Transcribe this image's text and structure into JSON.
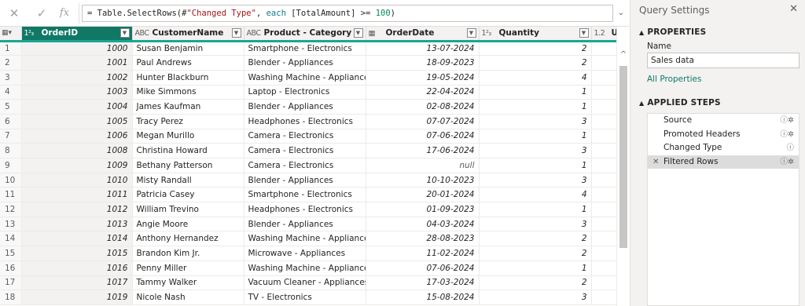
{
  "formula_bar": {
    "formula_parts": [
      {
        "text": "= Table.SelectRows(#",
        "cls": ""
      },
      {
        "text": "\"Changed Type\"",
        "cls": "str"
      },
      {
        "text": ", ",
        "cls": ""
      },
      {
        "text": "each",
        "cls": "kw"
      },
      {
        "text": " [TotalAmount] >= ",
        "cls": ""
      },
      {
        "text": "100",
        "cls": "num"
      },
      {
        "text": ")",
        "cls": ""
      }
    ]
  },
  "grid": {
    "columns": [
      {
        "type_icon": "1²₃",
        "label": "OrderID",
        "selected": true
      },
      {
        "type_icon": "ABC",
        "label": "CustomerName",
        "selected": false
      },
      {
        "type_icon": "ABC",
        "label": "Product - Category",
        "selected": false
      },
      {
        "type_icon": "▦",
        "label": "OrderDate",
        "selected": false
      },
      {
        "type_icon": "1²₃",
        "label": "Quantity",
        "selected": false
      },
      {
        "type_icon": "1.2",
        "label": "UnitPr",
        "selected": false
      }
    ],
    "rows": [
      {
        "n": "1",
        "id": "1000",
        "name": "Susan Benjamin",
        "product": "Smartphone - Electronics",
        "date": "13-07-2024",
        "qty": "2"
      },
      {
        "n": "2",
        "id": "1001",
        "name": "Paul Andrews",
        "product": "Blender - Appliances",
        "date": "18-09-2023",
        "qty": "2"
      },
      {
        "n": "3",
        "id": "1002",
        "name": "Hunter Blackburn",
        "product": "Washing Machine - Appliances",
        "date": "19-05-2024",
        "qty": "4"
      },
      {
        "n": "4",
        "id": "1003",
        "name": "Mike Simmons",
        "product": "Laptop - Electronics",
        "date": "22-04-2024",
        "qty": "1"
      },
      {
        "n": "5",
        "id": "1004",
        "name": "James Kaufman",
        "product": "Blender - Appliances",
        "date": "02-08-2024",
        "qty": "1"
      },
      {
        "n": "6",
        "id": "1005",
        "name": "Tracy Perez",
        "product": "Headphones - Electronics",
        "date": "07-07-2024",
        "qty": "3"
      },
      {
        "n": "7",
        "id": "1006",
        "name": "Megan Murillo",
        "product": "Camera - Electronics",
        "date": "07-06-2024",
        "qty": "1"
      },
      {
        "n": "8",
        "id": "1008",
        "name": "Christina Howard",
        "product": "Camera - Electronics",
        "date": "17-06-2024",
        "qty": "3"
      },
      {
        "n": "9",
        "id": "1009",
        "name": "Bethany Patterson",
        "product": "Camera - Electronics",
        "date": "null",
        "qty": "1"
      },
      {
        "n": "10",
        "id": "1010",
        "name": "Misty Randall",
        "product": "Blender - Appliances",
        "date": "10-10-2023",
        "qty": "3"
      },
      {
        "n": "11",
        "id": "1011",
        "name": "Patricia Casey",
        "product": "Smartphone - Electronics",
        "date": "20-01-2024",
        "qty": "4"
      },
      {
        "n": "12",
        "id": "1012",
        "name": "William Trevino",
        "product": "Headphones - Electronics",
        "date": "01-09-2023",
        "qty": "1"
      },
      {
        "n": "13",
        "id": "1013",
        "name": "Angie Moore",
        "product": "Blender - Appliances",
        "date": "04-03-2024",
        "qty": "3"
      },
      {
        "n": "14",
        "id": "1014",
        "name": "Anthony Hernandez",
        "product": "Washing Machine - Appliances",
        "date": "28-08-2023",
        "qty": "2"
      },
      {
        "n": "15",
        "id": "1015",
        "name": "Brandon Kim Jr.",
        "product": "Microwave - Appliances",
        "date": "11-02-2024",
        "qty": "2"
      },
      {
        "n": "16",
        "id": "1016",
        "name": "Penny Miller",
        "product": "Washing Machine - Appliances",
        "date": "07-06-2024",
        "qty": "1"
      },
      {
        "n": "17",
        "id": "1017",
        "name": "Tammy Walker",
        "product": "Vacuum Cleaner - Appliances",
        "date": "17-03-2024",
        "qty": "2"
      },
      {
        "n": "18",
        "id": "1019",
        "name": "Nicole Nash",
        "product": "TV - Electronics",
        "date": "15-08-2024",
        "qty": "3"
      }
    ]
  },
  "settings": {
    "title": "Query Settings",
    "properties_header": "PROPERTIES",
    "name_label": "Name",
    "name_value": "Sales data",
    "all_properties": "All Properties",
    "applied_steps_header": "APPLIED STEPS",
    "steps": [
      {
        "label": "Source",
        "icons": "ⓘ✲",
        "selected": false,
        "x": false
      },
      {
        "label": "Promoted Headers",
        "icons": "ⓘ✲",
        "selected": false,
        "x": false
      },
      {
        "label": "Changed Type",
        "icons": "ⓘ",
        "selected": false,
        "x": false
      },
      {
        "label": "Filtered Rows",
        "icons": "ⓘ✲",
        "selected": true,
        "x": true
      }
    ]
  }
}
